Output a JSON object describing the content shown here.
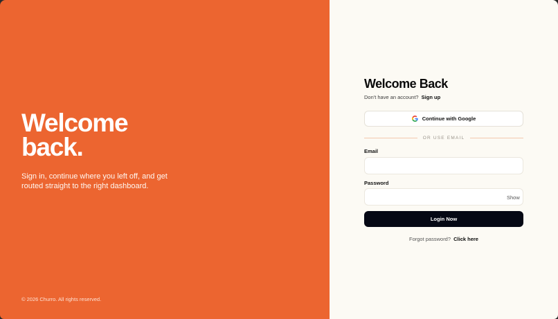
{
  "hero": {
    "title": "Welcome\nback.",
    "subtitle": "Sign in, continue where you left off, and get routed straight to the right dashboard.",
    "copyright": "© 2026 Churro. All rights reserved."
  },
  "form": {
    "title": "Welcome Back",
    "signup_prompt": "Don't have an account?",
    "signup_link": "Sign up",
    "google_button": "Continue with Google",
    "google_icon": "google-icon",
    "divider": "OR USE EMAIL",
    "email_label": "Email",
    "email_value": "",
    "password_label": "Password",
    "password_value": "",
    "show_label": "Show",
    "login_button": "Login Now",
    "forgot_prompt": "Forgot password?",
    "forgot_link": "Click here"
  },
  "colors": {
    "brand": "#EC6530",
    "panel": "#FCFAF4",
    "button_dark": "#050814"
  }
}
